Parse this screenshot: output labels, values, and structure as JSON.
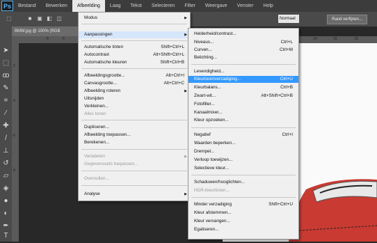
{
  "app": {
    "logo": "Ps"
  },
  "menubar": [
    "Bestand",
    "Bewerken",
    "Afbeelding",
    "Laag",
    "Tekst",
    "Selecteren",
    "Filter",
    "Weergave",
    "Venster",
    "Help"
  ],
  "optbar": {
    "rand_button": "Rand verfijnen...",
    "style_value": "Normaal"
  },
  "document": {
    "tab_label": "BMW.jpg @ 100% (RGB",
    "ruler_top": [
      "8",
      "6",
      "14",
      "16",
      "18"
    ],
    "ruler_left": [
      "2",
      "4",
      "6",
      "8"
    ]
  },
  "main_menu": {
    "items": [
      {
        "label": "Modus",
        "submenu": true
      },
      {
        "label": "Aanpassingen",
        "submenu": true
      },
      {
        "label": "Automatische tinten",
        "shortcut": "Shift+Ctrl+L"
      },
      {
        "label": "Autocontrast",
        "shortcut": "Alt+Shift+Ctrl+L"
      },
      {
        "label": "Automatische kleuren",
        "shortcut": "Shift+Ctrl+B"
      },
      {
        "label": "Afbeeldingsgrootte...",
        "shortcut": "Alt+Ctrl+I"
      },
      {
        "label": "Canvasgrootte...",
        "shortcut": "Alt+Ctrl+C"
      },
      {
        "label": "Afbeelding roteren",
        "submenu": true
      },
      {
        "label": "Uitsnijden"
      },
      {
        "label": "Verkleinen..."
      },
      {
        "label": "Alles tonen",
        "disabled": true
      },
      {
        "label": "Dupliceren..."
      },
      {
        "label": "Afbeelding toepassen..."
      },
      {
        "label": "Berekenen..."
      },
      {
        "label": "Variabelen",
        "submenu": true,
        "disabled": true
      },
      {
        "label": "Gegevenssets toepassen...",
        "disabled": true
      },
      {
        "label": "Overvullen...",
        "disabled": true
      },
      {
        "label": "Analyse",
        "submenu": true
      }
    ]
  },
  "sub_menu": {
    "items": [
      {
        "label": "Helderheid/contrast..."
      },
      {
        "label": "Niveaus...",
        "shortcut": "Ctrl+L"
      },
      {
        "label": "Curven...",
        "shortcut": "Ctrl+M"
      },
      {
        "label": "Belichting..."
      },
      {
        "label": "Levendigheid..."
      },
      {
        "label": "Kleurtoon/verzadiging...",
        "shortcut": "Ctrl+U"
      },
      {
        "label": "Kleurbalans...",
        "shortcut": "Ctrl+B"
      },
      {
        "label": "Zwart-wit...",
        "shortcut": "Alt+Shift+Ctrl+B"
      },
      {
        "label": "Fotofilter..."
      },
      {
        "label": "Kanaalmixer..."
      },
      {
        "label": "Kleur opzoeken..."
      },
      {
        "label": "Negatief",
        "shortcut": "Ctrl+I"
      },
      {
        "label": "Waarden beperken..."
      },
      {
        "label": "Drempel..."
      },
      {
        "label": "Verloop toewijzen..."
      },
      {
        "label": "Selectieve kleur..."
      },
      {
        "label": "Schaduwen/hooglichten..."
      },
      {
        "label": "HDR-kleurtinten...",
        "disabled": true
      },
      {
        "label": "Minder verzadiging",
        "shortcut": "Shift+Ctrl+U"
      },
      {
        "label": "Kleur afstemmen..."
      },
      {
        "label": "Kleur vervangen..."
      },
      {
        "label": "Egaliseren..."
      }
    ]
  }
}
